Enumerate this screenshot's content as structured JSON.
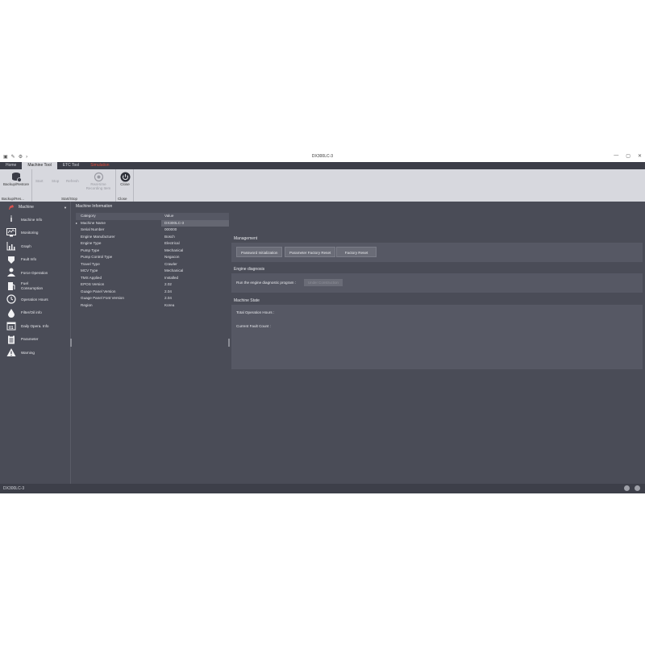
{
  "window": {
    "title": "DX300LC-3",
    "quick_access": [
      "▣",
      "✎",
      "⚙",
      "›"
    ],
    "controls": [
      "—",
      "▢",
      "✕"
    ]
  },
  "ribbon_tabs": [
    {
      "label": "Home"
    },
    {
      "label": "Machine Tool"
    },
    {
      "label": "ETC Tool"
    },
    {
      "label": "Simulation"
    }
  ],
  "ribbon": {
    "backup_restore": "Backup/Restore",
    "start": "Start",
    "stop": "Stop",
    "refresh": "Refresh",
    "realtime_line1": "Real-time",
    "realtime_line2": "Recording Item",
    "close": "Close",
    "group_backup": "Backup/Res...",
    "group_startstop": "Start/Stop",
    "group_close": "Close"
  },
  "nav": {
    "header": "Machine",
    "items": [
      {
        "label": "Machine Info",
        "icon": "info-icon"
      },
      {
        "label": "Monitoring",
        "icon": "monitor-icon"
      },
      {
        "label": "Graph",
        "icon": "graph-icon"
      },
      {
        "label": "Fault Info",
        "icon": "fault-icon"
      },
      {
        "label": "Force Operation",
        "icon": "person-icon"
      },
      {
        "label1": "Fuel",
        "label2": "Consumption",
        "icon": "fuel-icon"
      },
      {
        "label": "Operation Hours",
        "icon": "clock-icon"
      },
      {
        "label": "Filter/Oil info",
        "icon": "oil-icon"
      },
      {
        "label": "Daily Opera. Info",
        "icon": "calendar-icon"
      },
      {
        "label": "Parameter",
        "icon": "clipboard-icon"
      },
      {
        "label": "Warning",
        "icon": "warning-icon"
      }
    ]
  },
  "machine_info": {
    "title": "Machine Information",
    "headers": [
      "Category",
      "Value"
    ],
    "rows": [
      [
        "Machine Name",
        "DX300LC-3"
      ],
      [
        "Serial Number",
        "000000"
      ],
      [
        "Engine Manufacturer",
        "Bosch"
      ],
      [
        "Engine Type",
        "Electrical"
      ],
      [
        "Pump Type",
        "Mechanical"
      ],
      [
        "Pump Control Type",
        "Negacon"
      ],
      [
        "Travel Type",
        "Crawler"
      ],
      [
        "MCV Type",
        "Mechanical"
      ],
      [
        "TMS Applied",
        "Installed"
      ],
      [
        "EPOS Version",
        "2.02"
      ],
      [
        "Guage Panel Version",
        "2.04"
      ],
      [
        "Guage Panel Font Version",
        "2.04"
      ],
      [
        "Region",
        "Korea"
      ]
    ]
  },
  "management": {
    "title": "Management",
    "buttons": [
      "Password Initialization",
      "Parameter Factory Reset",
      "Factory Reset"
    ]
  },
  "engine_diagnosis": {
    "title": "Engine diagnosis",
    "label": "Run the engine diagnostic program :",
    "button": "Under Construction"
  },
  "machine_state": {
    "title": "Machine State",
    "total_hours": "Total Operation Hours :",
    "fault_count": "Current Fault Count :"
  },
  "status_bar": {
    "text": "DX300LC-3"
  },
  "colors": {
    "app_bg": "#4a4c57",
    "ribbon_bg": "#d7d8de",
    "panel_bg": "#565864",
    "accent_red": "#e04a3a"
  }
}
